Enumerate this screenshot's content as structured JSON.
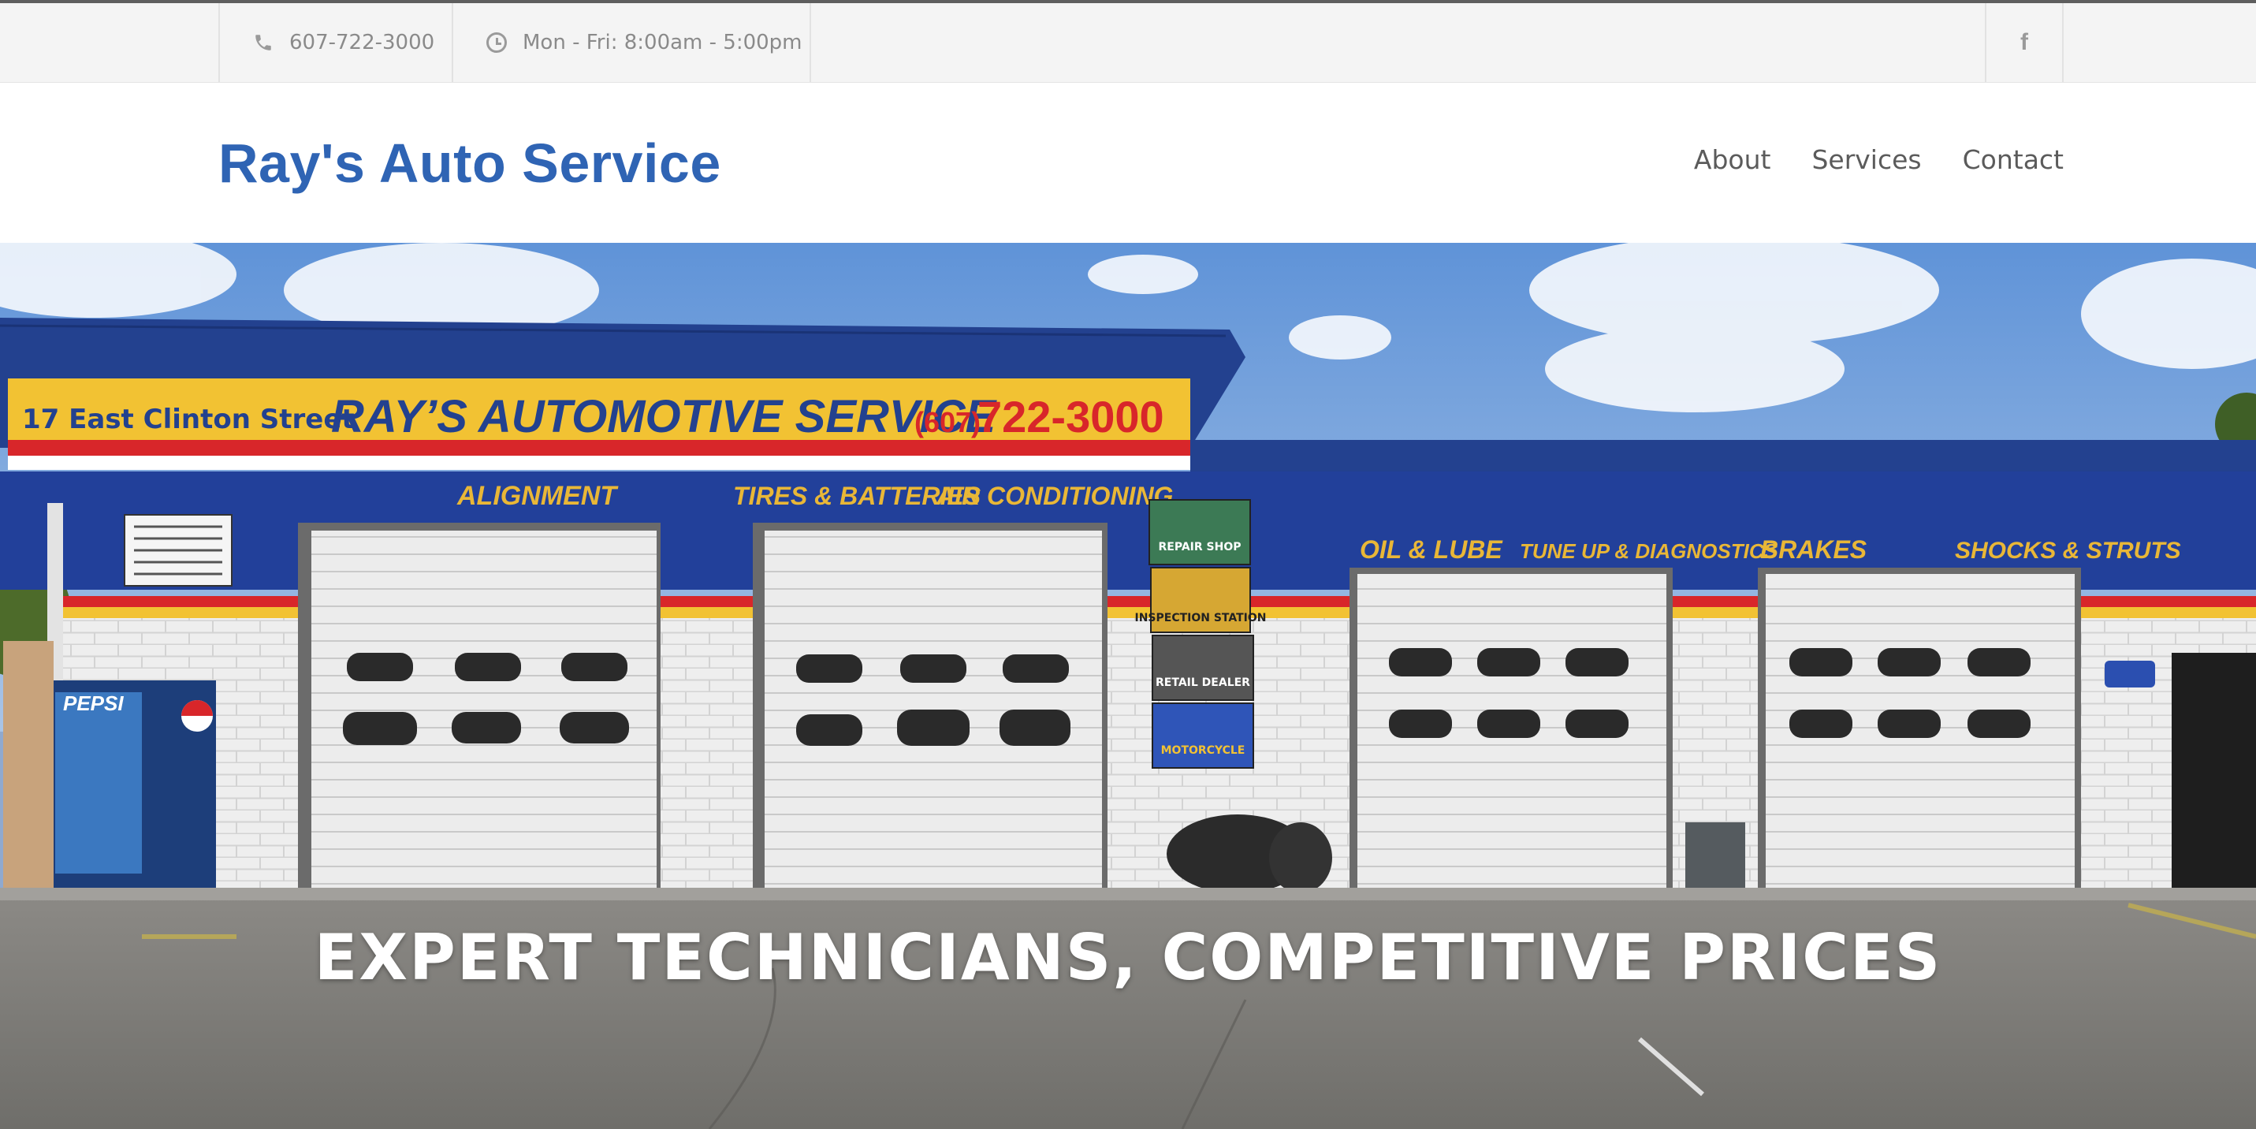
{
  "topbar": {
    "phone": "607-722-3000",
    "hours": "Mon - Fri: 8:00am - 5:00pm",
    "phone_icon": "phone-icon",
    "clock_icon": "clock-icon",
    "facebook_icon": "facebook-icon"
  },
  "header": {
    "brand": "Ray's Auto Service",
    "nav": [
      {
        "label": "About"
      },
      {
        "label": "Services"
      },
      {
        "label": "Contact"
      }
    ]
  },
  "hero": {
    "headline": "EXPERT TECHNICIANS, COMPETITIVE PRICES",
    "sign": {
      "street": "17 East Clinton Street",
      "name": "RAY’S AUTOMOTIVE SERVICE",
      "phone_area": "(607)",
      "phone": "722-3000"
    },
    "bays_left": [
      "ALIGNMENT",
      "TIRES & BATTERIES",
      "AIR CONDITIONING"
    ],
    "bays_right": [
      "OIL & LUBE",
      "TUNE UP & DIAGNOSTICS",
      "BRAKES",
      "SHOCKS & STRUTS"
    ],
    "certificates": [
      "REPAIR SHOP",
      "INSPECTION STATION",
      "RETAIL DEALER",
      "MOTORCYCLE"
    ],
    "vending": "PEPSI"
  },
  "colors": {
    "brand_blue": "#2f64b4",
    "topbar_bg": "#f4f4f4",
    "nav_text": "#5b5b5b",
    "sign_yellow": "#f2c233",
    "sign_red": "#d8262a",
    "building_blue": "#21409a"
  }
}
